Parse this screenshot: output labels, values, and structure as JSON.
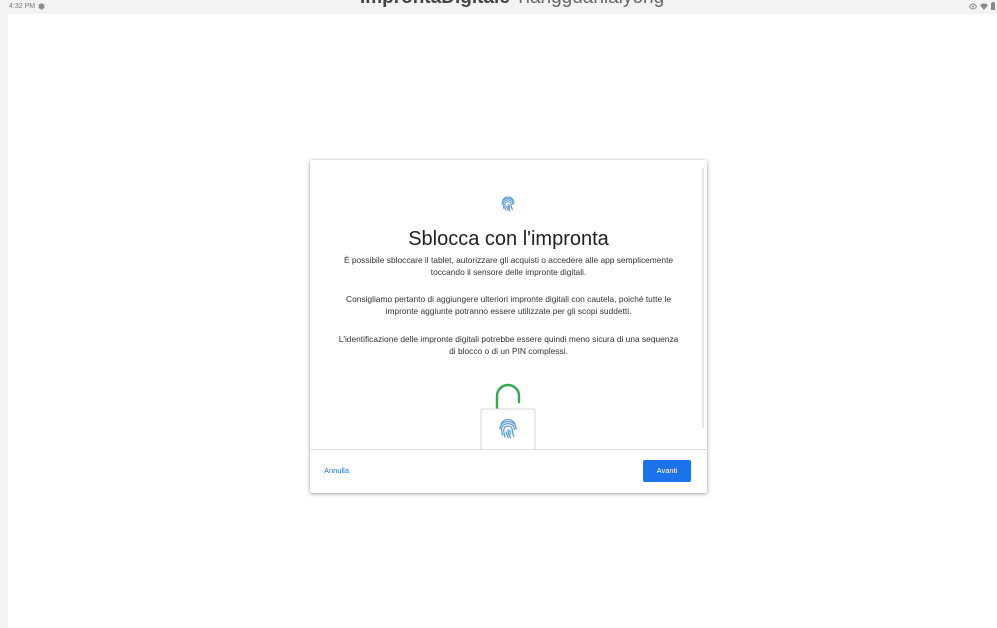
{
  "status_bar": {
    "time": "4:32 PM",
    "left_icon": "gear-icon",
    "right_icons": [
      "eye-icon",
      "wifi-icon",
      "battery-icon"
    ]
  },
  "overlay_title": {
    "bold": "ImprontaDigitale",
    "regular": "Tiangguanlaiyong"
  },
  "dialog": {
    "header_icon": "fingerprint-icon",
    "title": "Sblocca con l'impronta",
    "paragraphs": [
      "È possibile sbloccare il tablet, autorizzare gli acquisti o accedere alle app semplicemente toccando il sensore delle impronte digitali.",
      "Consigliamo pertanto di aggiungere ulteriori impronte digitali con cautela, poiché tutte le impronte aggiunte potranno essere utilizzate per gli scopi suddetti.",
      "L'identificazione delle impronte digitali potrebbe essere quindi meno sicura di una sequenza di blocco o di un PIN complessi."
    ],
    "illustration": "unlocked-padlock-fingerprint-icon",
    "buttons": {
      "cancel": "Annulla",
      "next": "Avanti"
    }
  },
  "colors": {
    "accent": "#1a73e8",
    "lock_shackle": "#34a853",
    "fingerprint": "#5f9fd8",
    "background": "#f3f3f3"
  }
}
